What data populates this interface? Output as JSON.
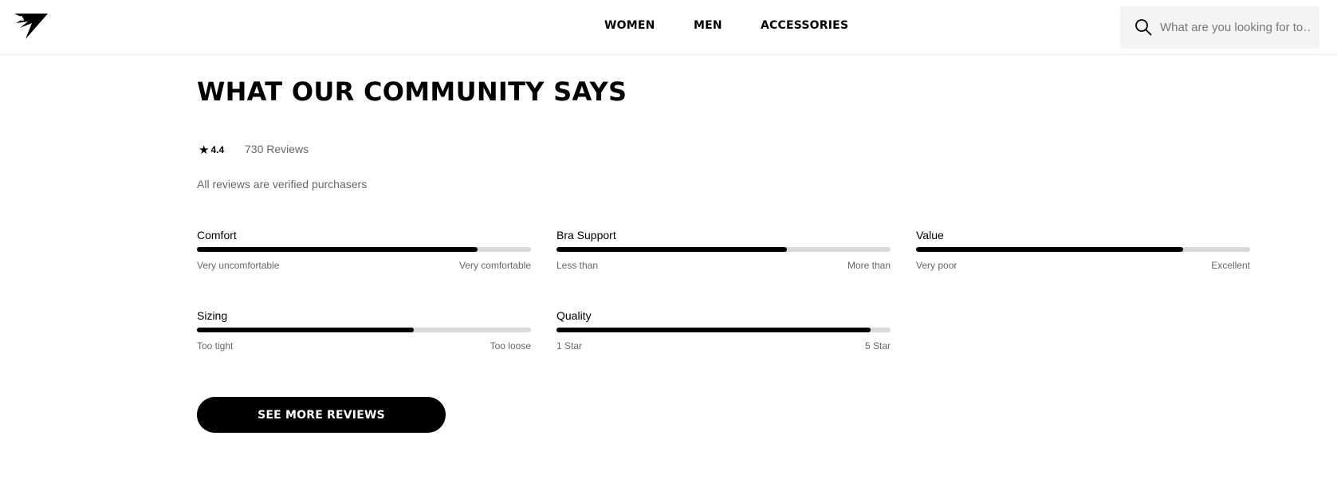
{
  "nav": {
    "items": [
      "WOMEN",
      "MEN",
      "ACCESSORIES"
    ]
  },
  "search": {
    "placeholder": "What are you looking for to…"
  },
  "reviews": {
    "title": "WHAT OUR COMMUNITY SAYS",
    "rating": "4.4",
    "count_label": "730 Reviews",
    "verified_text": "All reviews are verified purchasers",
    "see_more_label": "SEE MORE REVIEWS",
    "metrics": [
      {
        "label": "Comfort",
        "value": 0.84,
        "low": "Very uncomfortable",
        "high": "Very comfortable"
      },
      {
        "label": "Bra Support",
        "value": 0.69,
        "low": "Less than",
        "high": "More than"
      },
      {
        "label": "Value",
        "value": 0.8,
        "low": "Very poor",
        "high": "Excellent"
      },
      {
        "label": "Sizing",
        "value": 0.65,
        "low": "Too tight",
        "high": "Too loose"
      },
      {
        "label": "Quality",
        "value": 0.94,
        "low": "1 Star",
        "high": "5 Star"
      }
    ]
  },
  "colors": {
    "bar_fill": "#000000",
    "bar_track": "#d9d9d9",
    "muted_text": "#666666",
    "search_bg": "#f4f4f4"
  },
  "icons": {
    "logo": "brand-logo-icon",
    "search": "search-icon",
    "star": "star-icon"
  }
}
